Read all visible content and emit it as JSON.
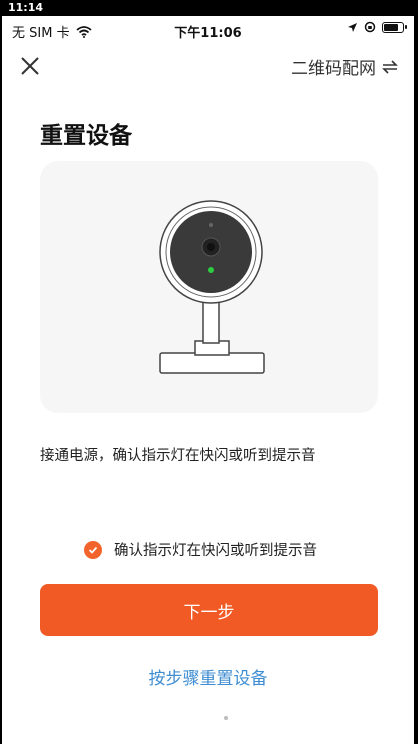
{
  "system_status": {
    "time": "11:14"
  },
  "status_bar": {
    "carrier": "无 SIM 卡",
    "time": "下午11:06"
  },
  "nav": {
    "mode_label": "二维码配网"
  },
  "page": {
    "title": "重置设备",
    "instruction": "接通电源，确认指示灯在快闪或听到提示音",
    "confirm_label": "确认指示灯在快闪或听到提示音",
    "confirm_checked": true,
    "next_label": "下一步",
    "step_link": "按步骤重置设备"
  },
  "colors": {
    "accent": "#f15a24",
    "link": "#3f8dd2",
    "indicator_led": "#2ecc40"
  }
}
